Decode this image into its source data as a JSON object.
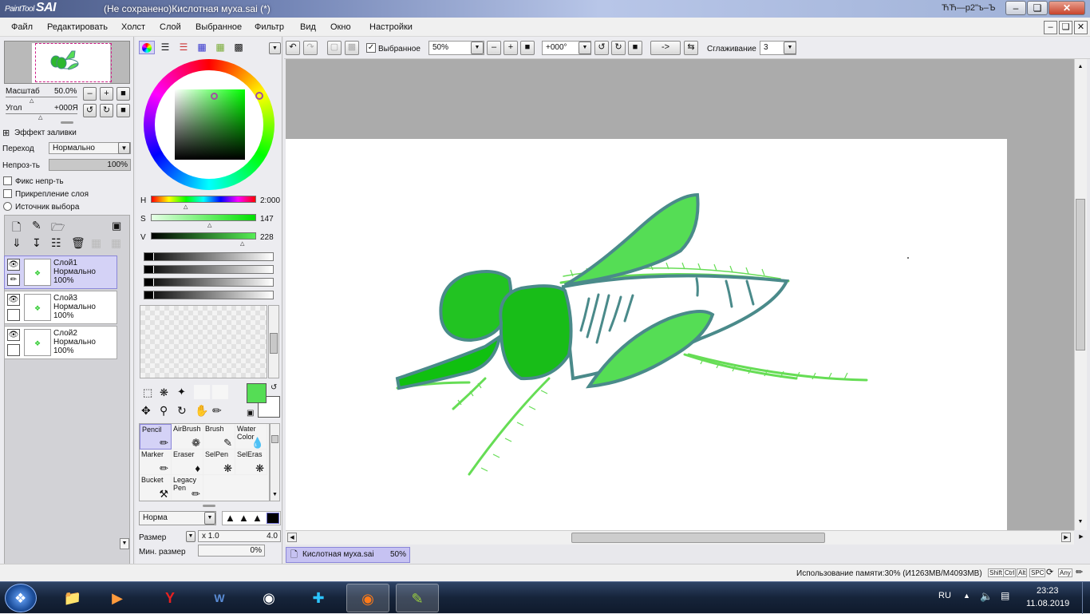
{
  "window": {
    "app_logo_prefix": "PaintTool",
    "app_logo": "SAI",
    "title": "(Не сохранено)Кислотная муха.sai (*)",
    "right_title": "ЋЋ—р2\"ъ–Ъ"
  },
  "menu": [
    "Файл",
    "Редактировать",
    "Холст",
    "Слой",
    "Выбранное",
    "Фильтр",
    "Вид",
    "Окно",
    "Настройки"
  ],
  "navigator": {
    "zoom_label": "Масштаб",
    "zoom_value": "50.0%",
    "angle_label": "Угол",
    "angle_value": "+000Я"
  },
  "layer_props": {
    "fill_effect": "Эффект заливки",
    "blend_label": "Переход",
    "blend_value": "Нормально",
    "opacity_label": "Непроз-ть",
    "opacity_value": "100%",
    "opacity_fraction": 1.0,
    "check_fix": "Фикс непр-ть",
    "check_clip": "Прикрепление слоя",
    "radio_source": "Источник выбора"
  },
  "layers": [
    {
      "name": "Слой1",
      "mode": "Нормально",
      "opacity": "100%",
      "selected": true
    },
    {
      "name": "Слой3",
      "mode": "Нормально",
      "opacity": "100%",
      "selected": false
    },
    {
      "name": "Слой2",
      "mode": "Нормально",
      "opacity": "100%",
      "selected": false
    }
  ],
  "color": {
    "h_label": "H",
    "h_value": "2:000",
    "s_label": "S",
    "s_value": "147",
    "v_label": "V",
    "v_value": "228",
    "current": "#55dd55",
    "secondary": "#ffffff"
  },
  "tools": [
    {
      "name": "Pencil",
      "selected": true
    },
    {
      "name": "AirBrush"
    },
    {
      "name": "Brush"
    },
    {
      "name": "Water Color"
    },
    {
      "name": "Marker"
    },
    {
      "name": "Eraser"
    },
    {
      "name": "SelPen"
    },
    {
      "name": "SelEras"
    },
    {
      "name": "Bucket"
    },
    {
      "name": "Legacy Pen"
    }
  ],
  "brush": {
    "mode_value": "Норма",
    "size_label": "Размер",
    "size_mult": "x 1.0",
    "size_value": "4.0",
    "min_size_label": "Мин. размер",
    "min_size_value": "0%"
  },
  "toolbar": {
    "selection_label": "Выбранное",
    "zoom_value": "50%",
    "angle_value": "+000°",
    "arrow_label": "->",
    "smoothing_label": "Сглаживание",
    "smoothing_value": "3"
  },
  "document_tab": {
    "name": "Кислотная муха.sai",
    "zoom": "50%"
  },
  "status": {
    "memory": "Использование памяти:30% (И1263MB/M4093MB)",
    "keys": [
      "Shift",
      "Ctrl",
      "Alt",
      "SPC",
      "Any"
    ]
  },
  "taskbar": {
    "language": "RU",
    "time": "23:23",
    "date": "11.08.2019"
  }
}
